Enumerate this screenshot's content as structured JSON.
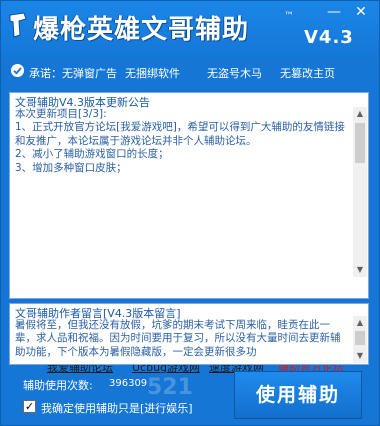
{
  "header": {
    "title": "爆枪英雄文哥辅助",
    "trademark": "™",
    "version": "V4.3"
  },
  "window_controls": {
    "minimize": "—",
    "close": "✕"
  },
  "pledge_bar": {
    "items": [
      "承诺：无弹窗广告",
      "无捆绑软件",
      "无盗号木马",
      "无篡改主页"
    ]
  },
  "update_panel": {
    "title": "文哥辅助V4.3版本更新公告",
    "text": "本次更新项目[3/3]:\n1、正式开放官方论坛[我爱游戏吧]，希望可以得到广大辅助的友情链接和友推广，本论坛属于游戏论坛并非个人辅助论坛。\n2、减小了辅助游戏窗口的长度；\n3、增加多种窗口皮肤；",
    "links": [
      "我爱辅助论坛",
      "Ucbug游戏网",
      "速度游戏网",
      "辅助官方论坛"
    ]
  },
  "author_panel": {
    "title": "文哥辅助作者留言[V4.3版本留言]",
    "text": "暑假将至，但我还没有放假，坑爹的期末考试下周来临，眭贡在此一辈，求人品和祝福。因为时间要用于复习，所以没有大量时间去更新辅助功能，下个版本为暑假隐藏版，一定会更新很多功"
  },
  "footer": {
    "usage_label": "辅助使用次数:",
    "usage_count": "396309",
    "confirm_label": "我确定使用辅助只是[进行娱乐]",
    "confirm_checked": "✓",
    "use_button": "使用辅助",
    "watermark": "521"
  },
  "colors": {
    "window_blue": "#1576d6",
    "panel_text": "#2a5fa6",
    "official_link": "#d01c1c"
  }
}
